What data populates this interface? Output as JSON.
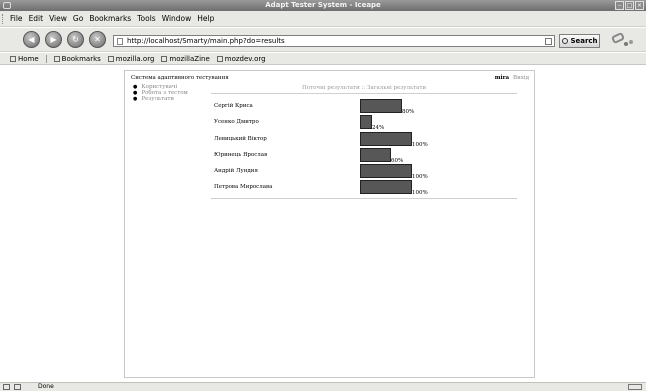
{
  "window": {
    "title": "Adapt Tester System - Iceape"
  },
  "menu": {
    "items": [
      "File",
      "Edit",
      "View",
      "Go",
      "Bookmarks",
      "Tools",
      "Window",
      "Help"
    ]
  },
  "nav": {
    "url": "http://localhost/Smarty/main.php?do=results",
    "search_label": "Search"
  },
  "bookmarks": {
    "items": [
      "Home",
      "Bookmarks",
      "mozilla.org",
      "mozillaZine",
      "mozdev.org"
    ]
  },
  "page": {
    "site_title": "Система адаптивного тестування",
    "user": "mira",
    "logout": "Вихід",
    "sidenav": [
      "Користувачі",
      "Робота з тестом",
      "Результати"
    ],
    "tabs": "Поточні результати :: Загальні результати",
    "results": [
      {
        "name": "Сергій Криса",
        "percent": 80,
        "label": "80%"
      },
      {
        "name": "Усенко Дмитро",
        "percent": 24,
        "label": "24%"
      },
      {
        "name": "Левицький Віктор",
        "percent": 100,
        "label": "100%"
      },
      {
        "name": "Юринець Ярослав",
        "percent": 60,
        "label": "60%"
      },
      {
        "name": "Андрій Лундия",
        "percent": 100,
        "label": "100%"
      },
      {
        "name": "Петрова Мирослава",
        "percent": 100,
        "label": "100%"
      }
    ]
  },
  "status": {
    "text": "Done"
  },
  "colors": {
    "bar": "#575757",
    "chrome": "#e8e8e4"
  }
}
